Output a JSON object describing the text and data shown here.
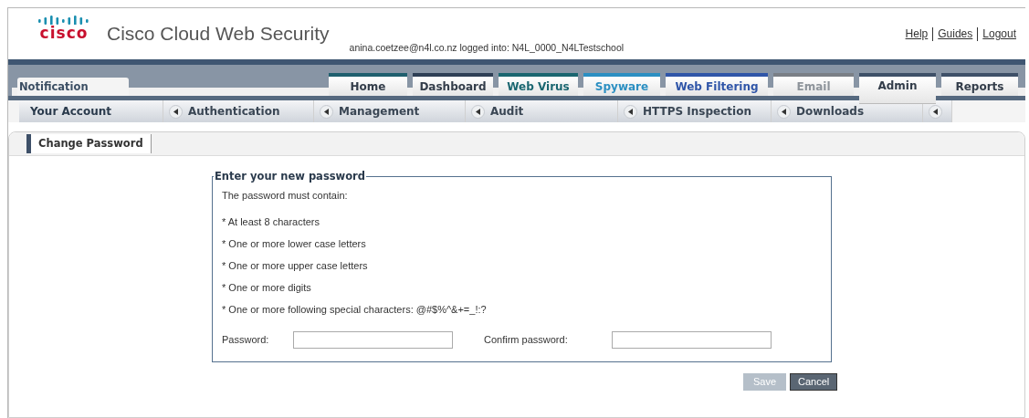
{
  "header": {
    "brand": "cisco",
    "title": "Cisco Cloud Web Security",
    "login_info": "anina.coetzee@n4l.co.nz logged into: N4L_0000_N4LTestschool",
    "links": [
      "Help",
      "Guides",
      "Logout"
    ]
  },
  "notification_tab": {
    "label": "Notification"
  },
  "tabs": [
    {
      "label": "Home",
      "color": "#1f5f6e",
      "selected": false,
      "disabled": false
    },
    {
      "label": "Dashboard",
      "color": "#2e3f55",
      "selected": false,
      "disabled": false
    },
    {
      "label": "Web Virus",
      "color": "#1a6670",
      "selected": false,
      "disabled": false
    },
    {
      "label": "Spyware",
      "color": "#2b8fc2",
      "selected": false,
      "disabled": false
    },
    {
      "label": "Web Filtering",
      "color": "#2f55a8",
      "selected": false,
      "disabled": false
    },
    {
      "label": "Email",
      "color": "#7a7f86",
      "selected": false,
      "disabled": true
    },
    {
      "label": "Admin",
      "color": "#3e5068",
      "selected": true,
      "disabled": false
    },
    {
      "label": "Reports",
      "color": "#3e5068",
      "selected": false,
      "disabled": false
    }
  ],
  "subnav": [
    {
      "label": "Your Account",
      "selected": true
    },
    {
      "label": "Authentication",
      "selected": false
    },
    {
      "label": "Management",
      "selected": false
    },
    {
      "label": "Audit",
      "selected": false
    },
    {
      "label": "HTTPS Inspection",
      "selected": false
    },
    {
      "label": "Downloads",
      "selected": false
    }
  ],
  "page_tab": {
    "label": "Change Password"
  },
  "form": {
    "legend": "Enter your new password",
    "intro": "The password must contain:",
    "rules": [
      "* At least 8 characters",
      "* One or more lower case letters",
      "* One or more upper case letters",
      "* One or more digits",
      "* One or more following special characters: @#$%^&+=_!:?"
    ],
    "fields": [
      {
        "label": "Password:"
      },
      {
        "label": "Confirm password:"
      }
    ]
  },
  "buttons": [
    {
      "label": "Save",
      "disabled": true
    },
    {
      "label": "Cancel",
      "disabled": false
    }
  ]
}
